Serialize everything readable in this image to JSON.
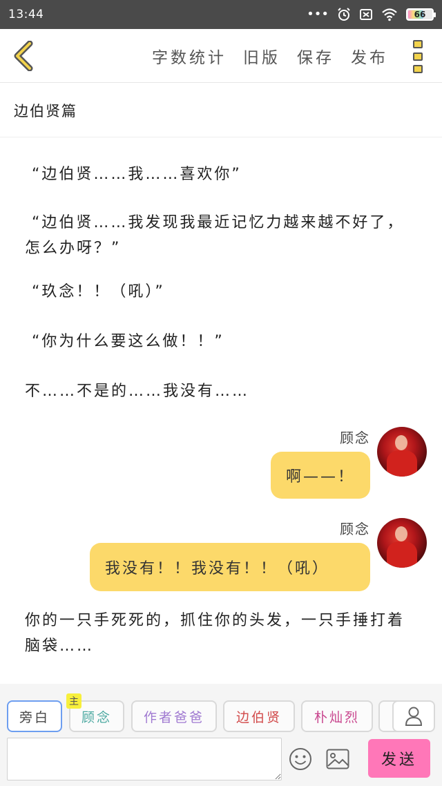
{
  "status_bar": {
    "time": "13:44",
    "icons": [
      "more-dots-icon",
      "alarm-icon",
      "sim-off-icon",
      "wifi-icon",
      "battery-icon"
    ],
    "battery": "66"
  },
  "toolbar": {
    "back_icon": "chevron-left-icon",
    "word_count": "字数统计",
    "old_version": "旧版",
    "save": "保存",
    "publish": "发布",
    "more_icon": "more-vertical-icon",
    "accent_color": "#f2d34c"
  },
  "chapter": {
    "title": "边伯贤篇"
  },
  "content": {
    "paragraphs": [
      "“边伯贤……我……喜欢你”",
      "“边伯贤……我发现我最近记忆力越来越不好了，怎么办呀？”",
      "“玖念！！（吼）”",
      "“你为什么要这么做！！”",
      "不……不是的……我没有……"
    ],
    "messages": [
      {
        "name": "顾念",
        "text": "啊——！"
      },
      {
        "name": "顾念",
        "text": "我没有！！我没有！！（吼）"
      }
    ],
    "closing_paragraph": "你的一只手死死的，抓住你的头发，一只手捶打着脑袋……"
  },
  "roles": {
    "items": [
      {
        "label": "旁白",
        "color": "#444444"
      },
      {
        "label": "顾念",
        "color": "#4aa8a0",
        "tag": "主"
      },
      {
        "label": "作者爸爸",
        "color": "#a07ad1"
      },
      {
        "label": "边伯贤",
        "color": "#d24b4b"
      },
      {
        "label": "朴灿烈",
        "color": "#c9478f"
      }
    ],
    "add_icon": "person-icon"
  },
  "composer": {
    "placeholder": "",
    "emoji_icon": "smiley-icon",
    "image_icon": "image-icon",
    "send_label": "发送",
    "send_color": "#ff77b8"
  }
}
